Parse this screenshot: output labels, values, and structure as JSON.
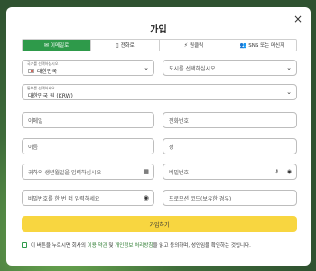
{
  "modal": {
    "title": "가입",
    "close": "×"
  },
  "tabs": [
    {
      "icon": "✉",
      "label": "이메일로"
    },
    {
      "icon": "▯",
      "label": "전화로"
    },
    {
      "icon": "⚡",
      "label": "원클릭"
    },
    {
      "icon": "👥",
      "label": "SNS 또는 메신저"
    }
  ],
  "fields": {
    "country_label": "국가를 선택하십시오",
    "country_value": "대한민국",
    "city_placeholder": "도시를 선택하십시오",
    "currency_label": "통화를 선택하세요",
    "currency_value": "대한민국 원 (KRW)",
    "email_placeholder": "이메일",
    "phone_placeholder": "전화번호",
    "first_name_placeholder": "이름",
    "last_name_placeholder": "성",
    "birthdate_placeholder": "귀하의 생년월일을 입력하십시오",
    "password_placeholder": "비밀번호",
    "password_repeat_placeholder": "비밀번호를 한 번 더 입력하세요",
    "promo_placeholder": "프로모션 코드(보유한 경우)"
  },
  "submit_label": "가입하기",
  "agree": {
    "prefix": "이 버튼을 누르시면 회사의",
    "terms": "이용 약관",
    "mid": "및",
    "privacy": "개인정보 처리방침",
    "suffix": "을 읽고 동의하며, 성인임을 확인하는 것입니다."
  },
  "colors": {
    "accent": "#2e9a4a",
    "submit": "#f8d640"
  }
}
